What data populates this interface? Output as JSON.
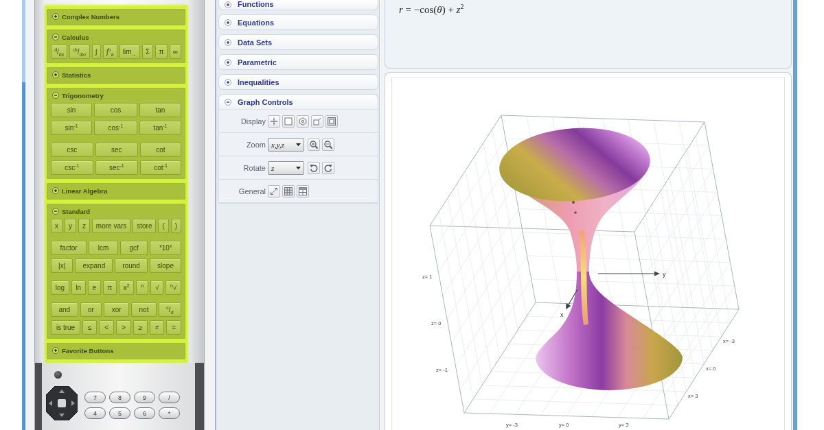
{
  "calculator": {
    "sections": [
      {
        "title": "Complex Numbers",
        "expanded": false
      },
      {
        "title": "Calculus",
        "expanded": true,
        "groups": [
          [
            [
              "$^{d}$/$_{dx}$",
              "$^{d²}$/$_{dx²}$",
              "∫",
              "∫$^{b}$$_{a}$",
              "lim$_{→}$",
              "Σ",
              "π",
              "∞"
            ]
          ]
        ]
      },
      {
        "title": "Statistics",
        "expanded": false
      },
      {
        "title": "Trigonometry",
        "expanded": true,
        "groups": [
          [
            [
              "sin",
              "cos",
              "tan"
            ],
            [
              "sin$^{-1}$",
              "cos$^{-1}$",
              "tan$^{-1}$"
            ]
          ],
          [
            [
              "csc",
              "sec",
              "cot"
            ],
            [
              "csc$^{-1}$",
              "sec$^{-1}$",
              "cot$^{-1}$"
            ]
          ]
        ]
      },
      {
        "title": "Linear Algebra",
        "expanded": false
      },
      {
        "title": "Standard",
        "expanded": true,
        "groups": [
          [
            [
              "x",
              "y",
              "z",
              "more vars",
              "store",
              "(",
              ")"
            ]
          ],
          [
            [
              "factor",
              "lcm",
              "gcf",
              "*10$^{x}$"
            ],
            [
              "|x|",
              "expand",
              "round",
              "slope"
            ]
          ],
          [
            [
              "log",
              "ln",
              "e",
              "π",
              "x$^{2}$",
              "^",
              "√",
              "$^{n}$√"
            ]
          ],
          [
            [
              "and",
              "or",
              "xor",
              "not",
              "$^{c}$/$_{d}$"
            ],
            [
              "is true",
              "≤",
              "<",
              ">",
              "≥",
              "≠",
              "="
            ]
          ]
        ]
      },
      {
        "title": "Favorite Buttons",
        "expanded": false
      }
    ],
    "keypad": [
      [
        "7",
        "8",
        "9",
        "/"
      ],
      [
        "4",
        "5",
        "6",
        "*"
      ]
    ]
  },
  "graph_panel": {
    "sections": [
      {
        "title": "Functions",
        "expanded": false
      },
      {
        "title": "Equations",
        "expanded": false
      },
      {
        "title": "Data Sets",
        "expanded": false
      },
      {
        "title": "Parametric",
        "expanded": false
      },
      {
        "title": "Inequalities",
        "expanded": false
      },
      {
        "title": "Graph Controls",
        "expanded": true,
        "controls": [
          {
            "label": "Display",
            "kind": "buttons"
          },
          {
            "label": "Zoom",
            "kind": "dropdown",
            "value": "x,y,z"
          },
          {
            "label": "Rotate",
            "kind": "dropdown",
            "value": "z"
          },
          {
            "label": "General",
            "kind": "buttons"
          }
        ]
      }
    ]
  },
  "equation": "*r* = −cos(*θ*) + *z*$^{2}$",
  "plot": {
    "axes": [
      {
        "label": "y"
      },
      {
        "label": "x"
      }
    ],
    "z_ticks": [
      "z= 1",
      "z= 0",
      "z= -1"
    ],
    "x_ticks": [
      "x= -3",
      "x= 0",
      "x= 3"
    ],
    "y_ticks": [
      "y= -3",
      "y= 0",
      "y= 3"
    ]
  }
}
